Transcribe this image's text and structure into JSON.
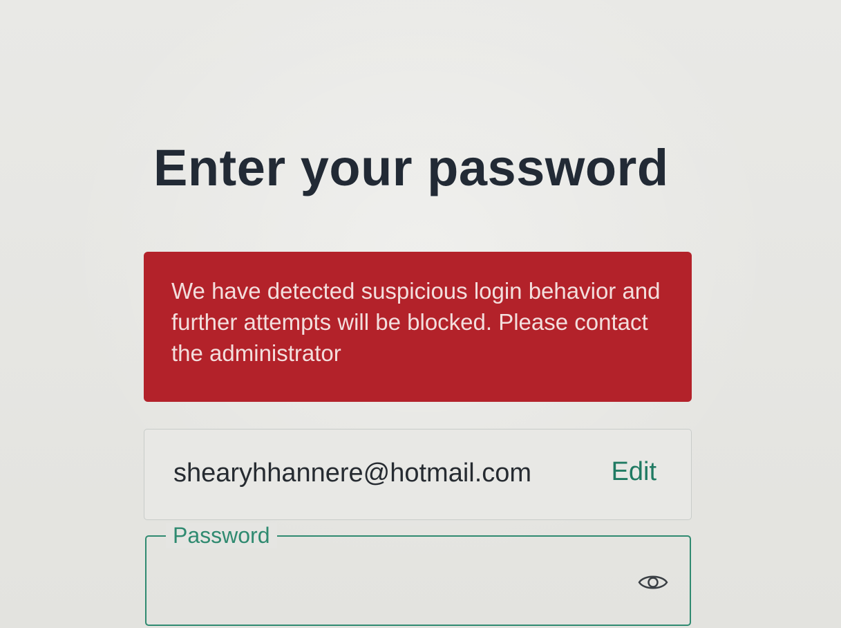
{
  "page": {
    "title": "Enter your password"
  },
  "alert": {
    "message": "We have detected suspicious login behavior and further attempts will be blocked. Please contact the administrator",
    "color": "#b3222a"
  },
  "account": {
    "email": "shearyhhannere@hotmail.com",
    "edit_label": "Edit"
  },
  "password_field": {
    "label": "Password",
    "value": "",
    "toggle_icon": "eye-icon",
    "accent_color": "#2f8a70"
  }
}
